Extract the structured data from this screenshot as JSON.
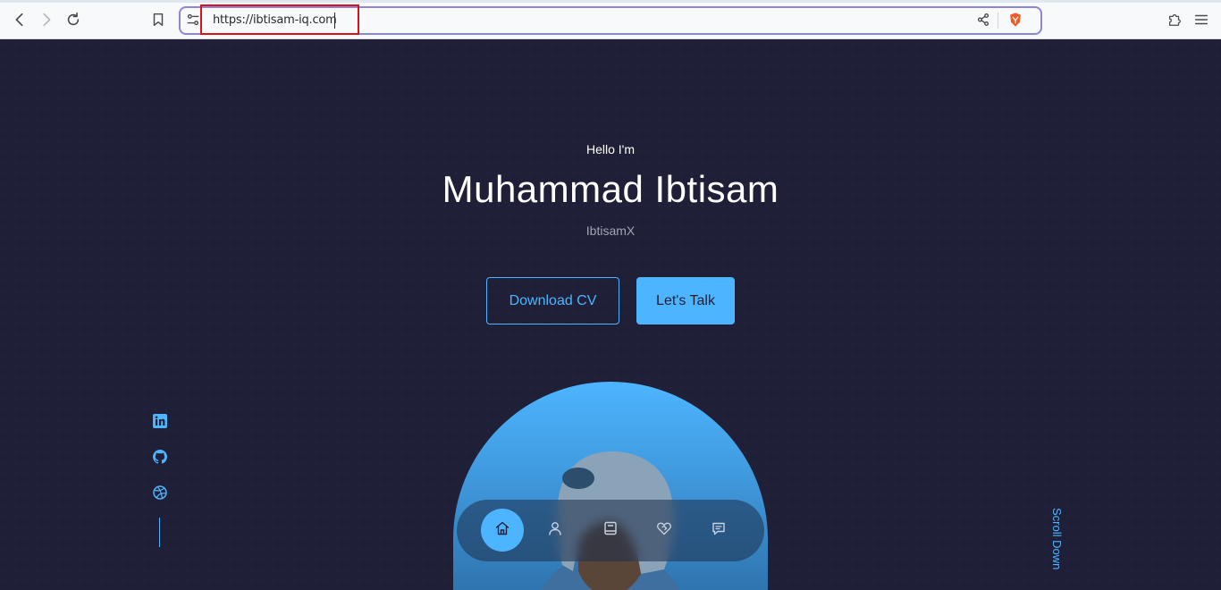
{
  "browser": {
    "url": "https://ibtisam-iq.com",
    "icons": {
      "back": "back-arrow-icon",
      "forward": "forward-arrow-icon",
      "reload": "reload-icon",
      "bookmark": "bookmark-icon",
      "site_settings": "site-settings-icon",
      "share": "share-icon",
      "brave_shield": "brave-shield-icon",
      "extensions": "puzzle-icon",
      "menu": "hamburger-menu-icon"
    }
  },
  "hero": {
    "greeting": "Hello I'm",
    "name": "Muhammad Ibtisam",
    "handle": "IbtisamX",
    "download_cv_label": "Download CV",
    "lets_talk_label": "Let's Talk",
    "scroll_down_label": "Scroll Down"
  },
  "socials": [
    {
      "icon": "linkedin-icon"
    },
    {
      "icon": "github-icon"
    },
    {
      "icon": "dribbble-icon"
    }
  ],
  "bottom_nav": [
    {
      "icon": "home-icon",
      "active": true
    },
    {
      "icon": "user-icon",
      "active": false
    },
    {
      "icon": "book-icon",
      "active": false
    },
    {
      "icon": "heart-handshake-icon",
      "active": false
    },
    {
      "icon": "message-icon",
      "active": false
    }
  ],
  "colors": {
    "page_bg": "#1f1f38",
    "accent": "#4db5ff",
    "text_muted": "#a0a3b6",
    "url_focus_border": "#8b86d8",
    "highlight_box": "#d9121b"
  }
}
